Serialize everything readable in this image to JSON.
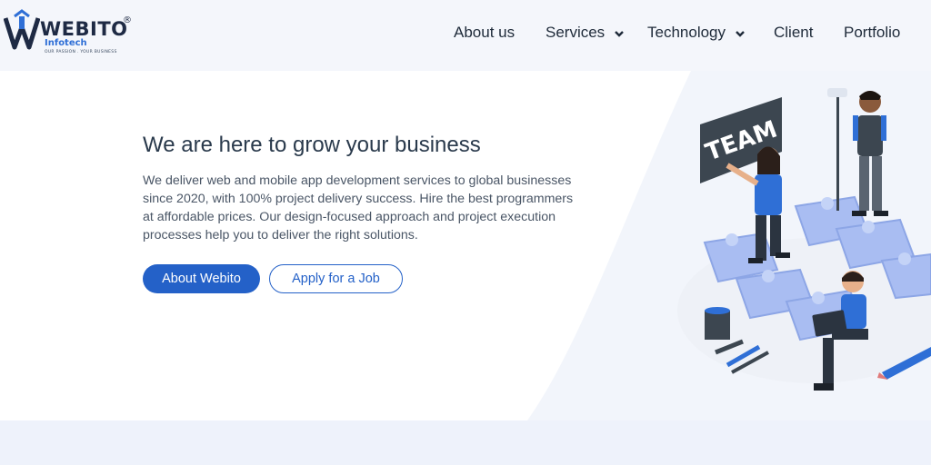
{
  "brand": {
    "name": "WEBITO",
    "registered": "®",
    "sub": "Infotech",
    "tagline": "OUR PASSION . YOUR BUSINESS"
  },
  "nav": {
    "items": [
      {
        "label": "About us",
        "has_dropdown": false
      },
      {
        "label": "Services",
        "has_dropdown": true
      },
      {
        "label": "Technology",
        "has_dropdown": true
      },
      {
        "label": "Client",
        "has_dropdown": false
      },
      {
        "label": "Portfolio",
        "has_dropdown": false
      }
    ]
  },
  "hero": {
    "title": "We are here to grow your business",
    "description": "We deliver web and mobile app development services to global businesses since 2020, with 100% project delivery success. Hire the best programmers at affordable prices. Our design-focused approach and project execution processes help you to deliver the right solutions.",
    "primary_button": "About Webito",
    "secondary_button": "Apply for a Job",
    "illustration_sign": "TEAM"
  },
  "colors": {
    "accent": "#2461c8",
    "puzzle": "#a9bdf2",
    "dark": "#1f2b3a"
  }
}
